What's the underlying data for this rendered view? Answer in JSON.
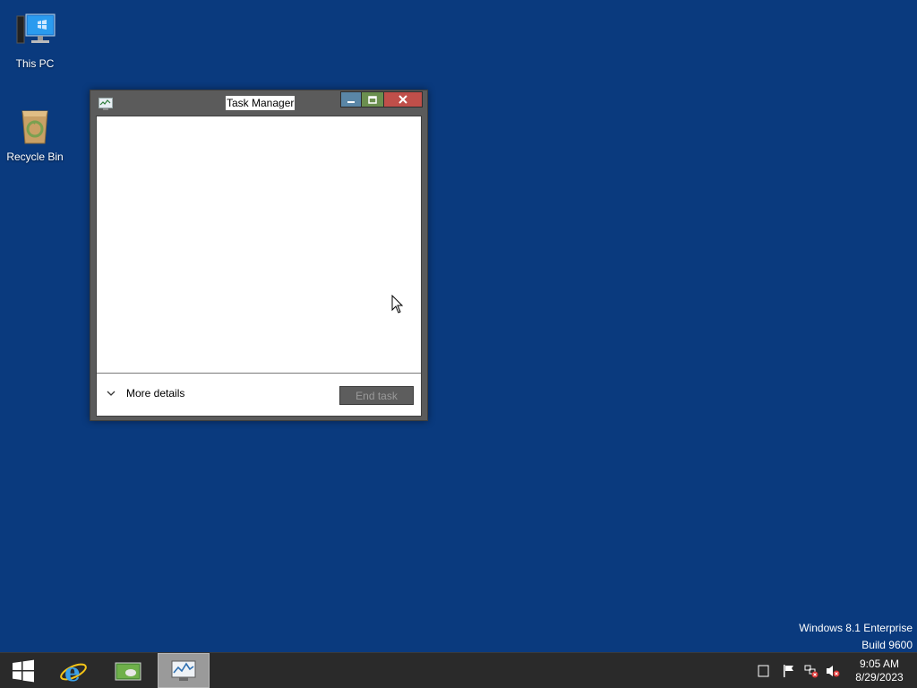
{
  "desktop": {
    "background_color": "#0a3a7e",
    "icons": [
      {
        "label": "This PC",
        "icon": "computer-icon"
      },
      {
        "label": "Recycle Bin",
        "icon": "recycle-bin-icon"
      }
    ]
  },
  "window": {
    "title": "Task Manager",
    "title_icon": "task-manager-icon",
    "controls": {
      "minimize": "minimize-icon",
      "maximize": "maximize-icon",
      "close": "close-icon"
    },
    "footer": {
      "more_details_label": "More details",
      "end_task_label": "End task",
      "end_task_enabled": false
    }
  },
  "watermark": {
    "line1": "Windows 8.1 Enterprise",
    "line2": "Build 9600"
  },
  "taskbar": {
    "buttons": [
      {
        "name": "start",
        "icon": "windows-logo-icon"
      },
      {
        "name": "internet-explorer",
        "icon": "internet-explorer-icon"
      },
      {
        "name": "file-explorer",
        "icon": "file-explorer-icon"
      },
      {
        "name": "task-manager",
        "icon": "task-manager-icon",
        "active": true
      }
    ],
    "tray": {
      "icons": [
        "show-desktop-icon",
        "action-center-flag-icon",
        "network-error-icon",
        "volume-muted-icon"
      ],
      "time": "9:05 AM",
      "date": "8/29/2023"
    }
  }
}
